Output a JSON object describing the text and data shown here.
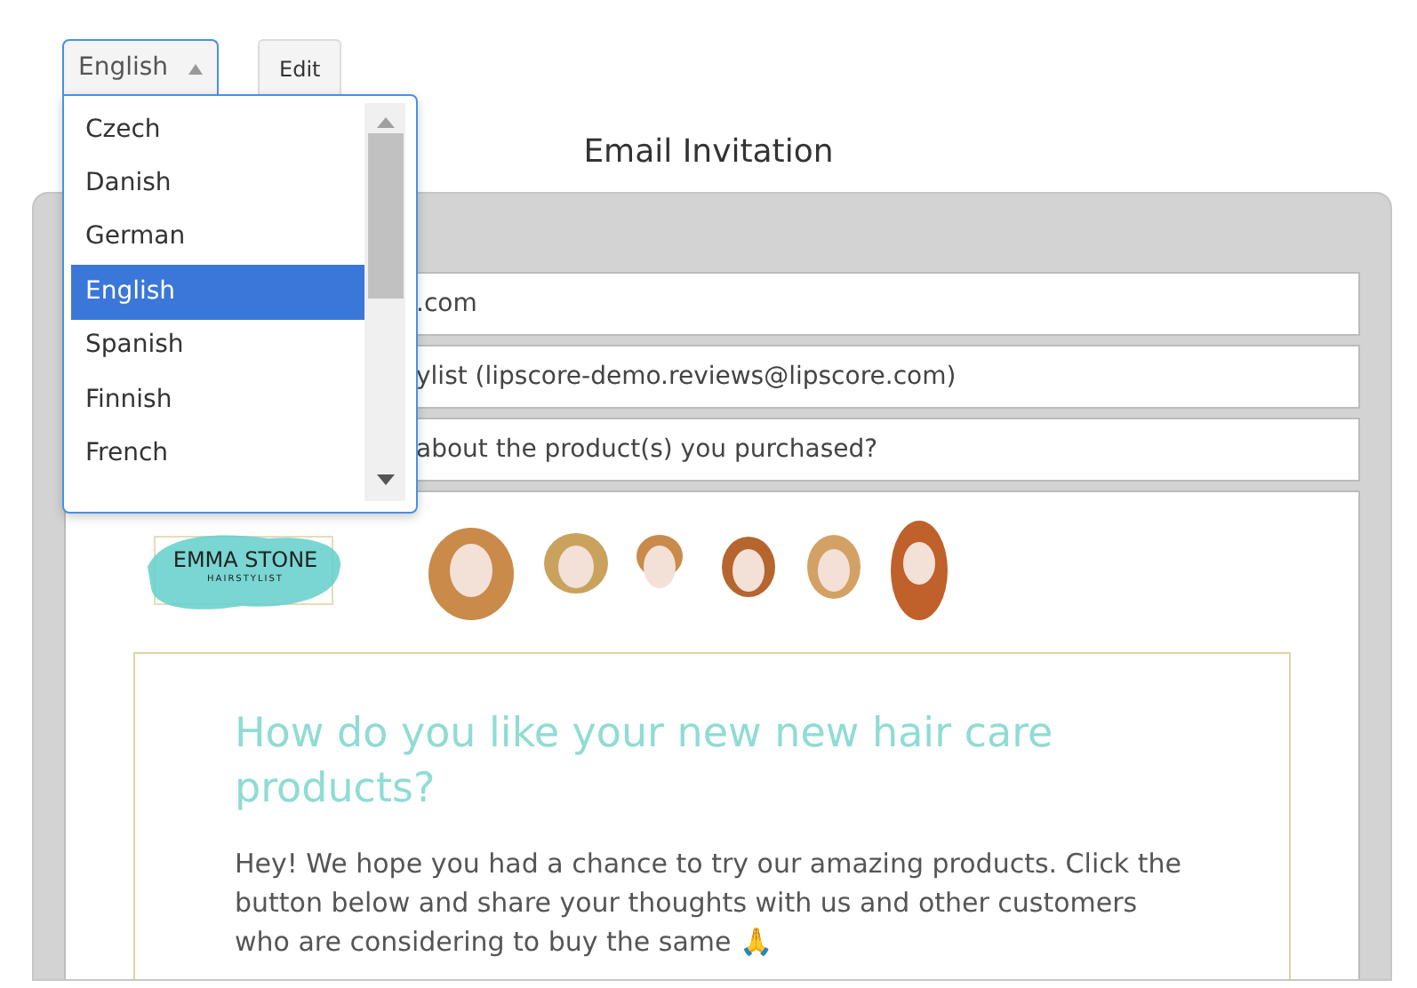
{
  "language_select": {
    "value": "English",
    "expanded": true
  },
  "edit_button": "Edit",
  "title": "Email Invitation",
  "language_options": [
    {
      "label": "Czech",
      "selected": false
    },
    {
      "label": "Danish",
      "selected": false
    },
    {
      "label": "German",
      "selected": false
    },
    {
      "label": "English",
      "selected": true
    },
    {
      "label": "Spanish",
      "selected": false
    },
    {
      "label": "Finnish",
      "selected": false
    },
    {
      "label": "French",
      "selected": false
    }
  ],
  "fields": [
    ".com",
    "ylist (lipscore-demo.reviews@lipscore.com)",
    "about the product(s) you purchased?"
  ],
  "email": {
    "logo_name": "EMMA STONE",
    "logo_tagline": "HAIRSTYLIST",
    "heading": "How do you like your new new hair care products?",
    "body": "Hey! We hope you had a chance to try our amazing products. Click the button below and share your thoughts with us and other customers who are considering to buy the same 🙏"
  }
}
